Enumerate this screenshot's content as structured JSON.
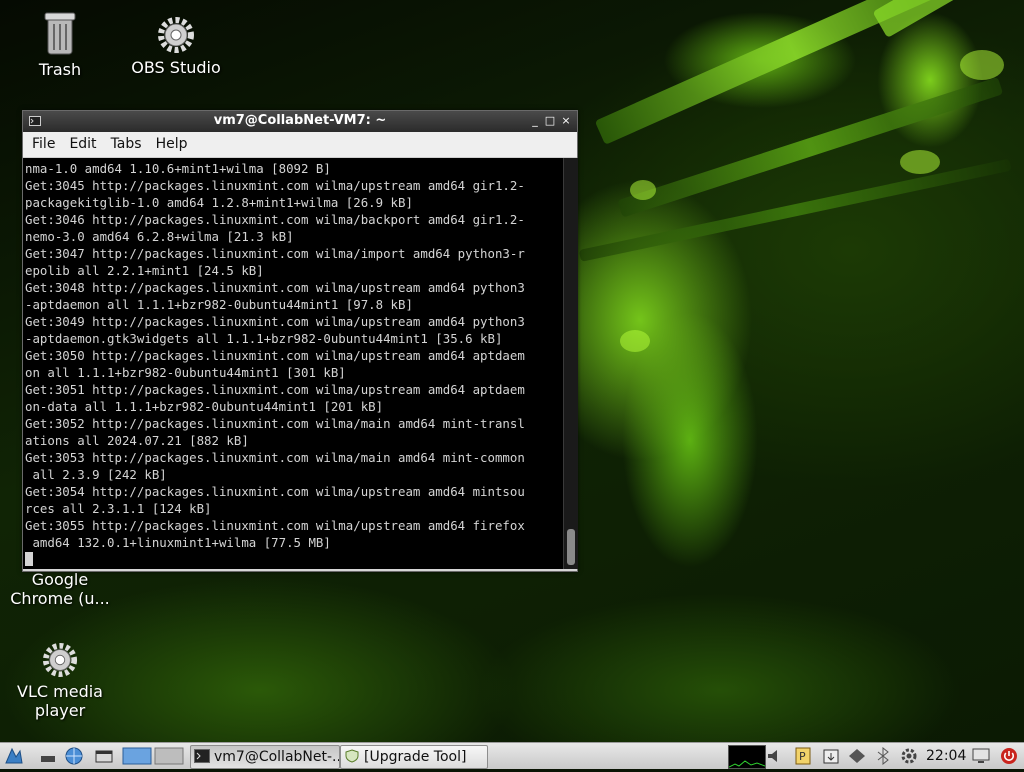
{
  "desktop": {
    "icons": [
      {
        "label": "Trash",
        "icon": "trash-icon"
      },
      {
        "label": "OBS Studio",
        "icon": "gear-icon"
      },
      {
        "label": "Google Chrome (u...",
        "icon": "chrome-icon"
      },
      {
        "label": "VLC media player",
        "icon": "gear-icon"
      }
    ]
  },
  "terminal": {
    "title": "vm7@CollabNet-VM7: ~",
    "menu": [
      "File",
      "Edit",
      "Tabs",
      "Help"
    ],
    "lines": [
      "nma-1.0 amd64 1.10.6+mint1+wilma [8092 B]",
      "Get:3045 http://packages.linuxmint.com wilma/upstream amd64 gir1.2-",
      "packagekitglib-1.0 amd64 1.2.8+mint1+wilma [26.9 kB]",
      "Get:3046 http://packages.linuxmint.com wilma/backport amd64 gir1.2-",
      "nemo-3.0 amd64 6.2.8+wilma [21.3 kB]",
      "Get:3047 http://packages.linuxmint.com wilma/import amd64 python3-r",
      "epolib all 2.2.1+mint1 [24.5 kB]",
      "Get:3048 http://packages.linuxmint.com wilma/upstream amd64 python3",
      "-aptdaemon all 1.1.1+bzr982-0ubuntu44mint1 [97.8 kB]",
      "Get:3049 http://packages.linuxmint.com wilma/upstream amd64 python3",
      "-aptdaemon.gtk3widgets all 1.1.1+bzr982-0ubuntu44mint1 [35.6 kB]",
      "Get:3050 http://packages.linuxmint.com wilma/upstream amd64 aptdaem",
      "on all 1.1.1+bzr982-0ubuntu44mint1 [301 kB]",
      "Get:3051 http://packages.linuxmint.com wilma/upstream amd64 aptdaem",
      "on-data all 1.1.1+bzr982-0ubuntu44mint1 [201 kB]",
      "Get:3052 http://packages.linuxmint.com wilma/main amd64 mint-transl",
      "ations all 2024.07.21 [882 kB]",
      "Get:3053 http://packages.linuxmint.com wilma/main amd64 mint-common",
      " all 2.3.9 [242 kB]",
      "Get:3054 http://packages.linuxmint.com wilma/upstream amd64 mintsou",
      "rces all 2.3.1.1 [124 kB]",
      "Get:3055 http://packages.linuxmint.com wilma/upstream amd64 firefox",
      " amd64 132.0.1+linuxmint1+wilma [77.5 MB]"
    ]
  },
  "taskbar": {
    "tasks": [
      {
        "label": "vm7@CollabNet-...",
        "active": true
      },
      {
        "label": "[Upgrade Tool]",
        "active": false
      }
    ],
    "clock": "22:04"
  }
}
